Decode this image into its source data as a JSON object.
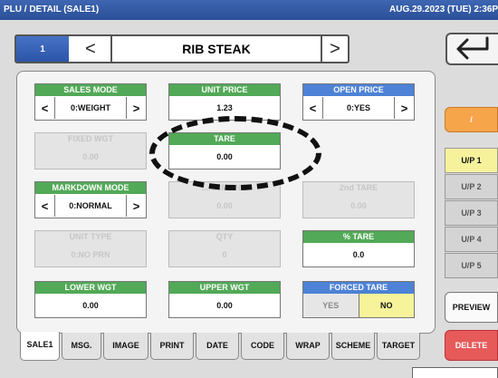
{
  "titlebar": {
    "screen": "PLU / DETAIL (SALE1)",
    "datetime": "AUG.29.2023 (TUE)  2:36P"
  },
  "nav": {
    "plu_number": "1",
    "prev": "<",
    "next": ">",
    "item_name": "RIB STEAK"
  },
  "fields": {
    "sales_mode": {
      "label": "SALES MODE",
      "value": "0:WEIGHT",
      "prev": "<",
      "next": ">"
    },
    "unit_price": {
      "label": "UNIT PRICE",
      "value": "1.23"
    },
    "open_price": {
      "label": "OPEN PRICE",
      "value": "0:YES",
      "prev": "<",
      "next": ">"
    },
    "fixed_wgt": {
      "label": "FIXED WGT",
      "value": "0.00"
    },
    "tare": {
      "label": "TARE",
      "value": "0.00"
    },
    "markdown_mode": {
      "label": "MARKDOWN MODE",
      "value": "0:NORMAL",
      "prev": "<",
      "next": ">"
    },
    "markdown_hidden": {
      "label": "...A...M...N...",
      "value": "0.00"
    },
    "second_tare": {
      "label": "2nd TARE",
      "value": "0.00"
    },
    "unit_type": {
      "label": "UNIT TYPE",
      "value": "0:NO PRN"
    },
    "qty": {
      "label": "QTY",
      "value": "0"
    },
    "pct_tare": {
      "label": "% TARE",
      "value": "0.0"
    },
    "lower_wgt": {
      "label": "LOWER WGT",
      "value": "0.00"
    },
    "upper_wgt": {
      "label": "UPPER WGT",
      "value": "0.00"
    },
    "forced_tare": {
      "label": "FORCED TARE",
      "yes": "YES",
      "no": "NO",
      "selected": "NO"
    }
  },
  "side": {
    "slash": "/",
    "unit_prices": [
      "U/P 1",
      "U/P 2",
      "U/P 3",
      "U/P 4",
      "U/P 5"
    ],
    "active_index": 0,
    "preview": "PREVIEW",
    "delete": "DELETE"
  },
  "tabs": [
    "SALE1",
    "MSG.",
    "IMAGE",
    "PRINT",
    "DATE",
    "CODE",
    "WRAP",
    "SCHEME",
    "TARGET"
  ],
  "active_tab": "SALE1",
  "icons": {
    "back": "return-arrow-icon"
  },
  "colors": {
    "header_green": "#52a957",
    "header_blue": "#4d82d6",
    "title_blue": "#2b4f98",
    "active_yellow": "#f6f29b",
    "delete_red": "#e65a5a",
    "slash_orange": "#f6a54b"
  }
}
